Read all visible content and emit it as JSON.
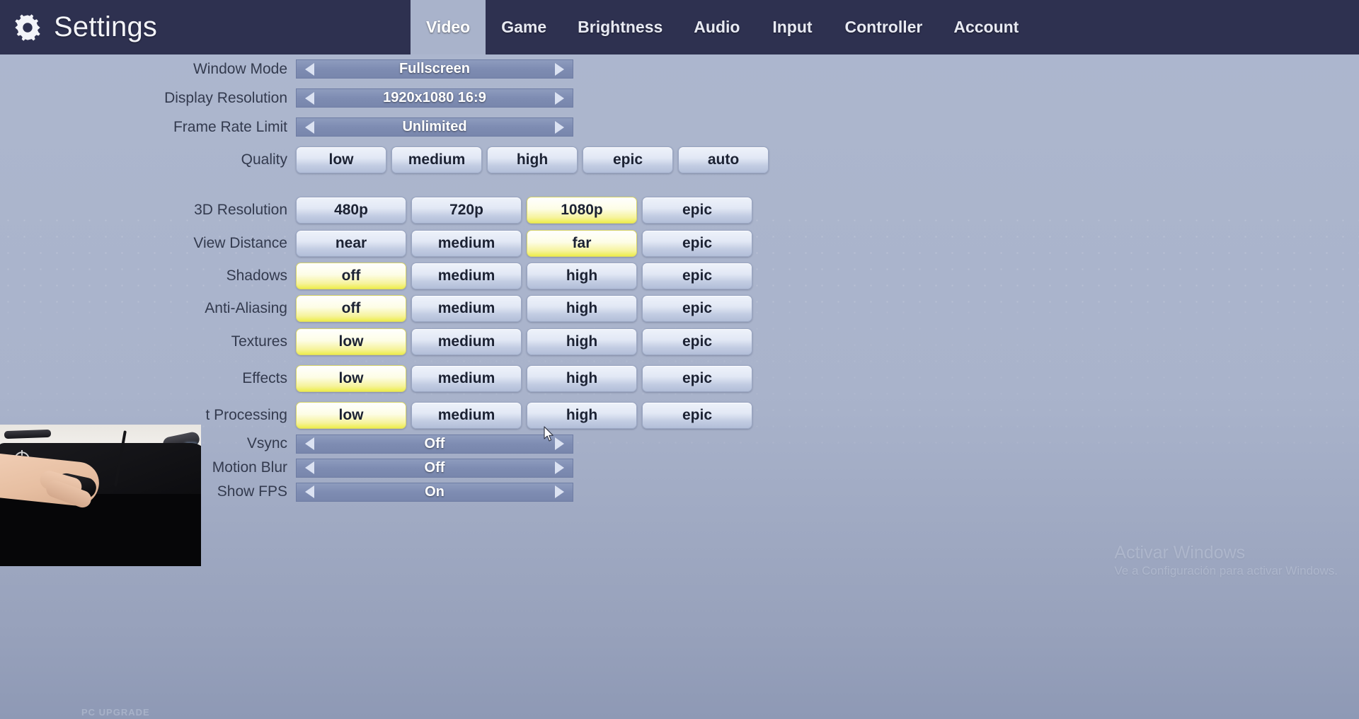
{
  "header": {
    "title": "Settings",
    "gear_icon": "gear-icon",
    "tabs": [
      {
        "label": "Video",
        "active": true
      },
      {
        "label": "Game",
        "active": false
      },
      {
        "label": "Brightness",
        "active": false
      },
      {
        "label": "Audio",
        "active": false
      },
      {
        "label": "Input",
        "active": false
      },
      {
        "label": "Controller",
        "active": false
      },
      {
        "label": "Account",
        "active": false
      }
    ]
  },
  "settings": {
    "selectors_top": [
      {
        "label": "Window Mode",
        "value": "Fullscreen",
        "left_arrow": "caret-left-icon",
        "right_arrow": "caret-right-icon"
      },
      {
        "label": "Display Resolution",
        "value": "1920x1080 16:9",
        "left_arrow": "caret-left-icon",
        "right_arrow": "caret-right-icon"
      },
      {
        "label": "Frame Rate Limit",
        "value": "Unlimited",
        "left_arrow": "caret-left-icon",
        "right_arrow": "caret-right-icon"
      }
    ],
    "quality": {
      "label": "Quality",
      "options": [
        "low",
        "medium",
        "high",
        "epic",
        "auto"
      ],
      "selected": null
    },
    "option_rows": [
      {
        "label": "3D Resolution",
        "options": [
          "480p",
          "720p",
          "1080p",
          "epic"
        ],
        "selected": "1080p"
      },
      {
        "label": "View Distance",
        "options": [
          "near",
          "medium",
          "far",
          "epic"
        ],
        "selected": "far"
      },
      {
        "label": "Shadows",
        "options": [
          "off",
          "medium",
          "high",
          "epic"
        ],
        "selected": "off"
      },
      {
        "label": "Anti-Aliasing",
        "options": [
          "off",
          "medium",
          "high",
          "epic"
        ],
        "selected": "off"
      },
      {
        "label": "Textures",
        "options": [
          "low",
          "medium",
          "high",
          "epic"
        ],
        "selected": "low"
      },
      {
        "label": "Effects",
        "options": [
          "low",
          "medium",
          "high",
          "epic"
        ],
        "selected": "low"
      },
      {
        "label": "t Processing",
        "options": [
          "low",
          "medium",
          "high",
          "epic"
        ],
        "selected": "low"
      }
    ],
    "selectors_bottom": [
      {
        "label": "Vsync",
        "value": "Off",
        "left_arrow": "caret-left-icon",
        "right_arrow": "caret-right-icon"
      },
      {
        "label": "Motion Blur",
        "value": "Off",
        "left_arrow": "caret-left-icon",
        "right_arrow": "caret-right-icon"
      },
      {
        "label": "Show FPS",
        "value": "On",
        "left_arrow": "caret-left-icon",
        "right_arrow": "caret-right-icon"
      }
    ]
  },
  "watermark": {
    "line1": "Activar Windows",
    "line2": "Ve a Configuración para activar Windows."
  },
  "overlay": {
    "corner_text": "PC UPGRADE"
  },
  "colors": {
    "header_bg": "#2e3150",
    "body_bg": "#a9b3cb",
    "selector_bar": "#7e8cb2",
    "option_bg": "#dde4f2",
    "option_selected": "#eded4a",
    "text_dark": "#1c2233",
    "text_light": "#ffffff"
  }
}
